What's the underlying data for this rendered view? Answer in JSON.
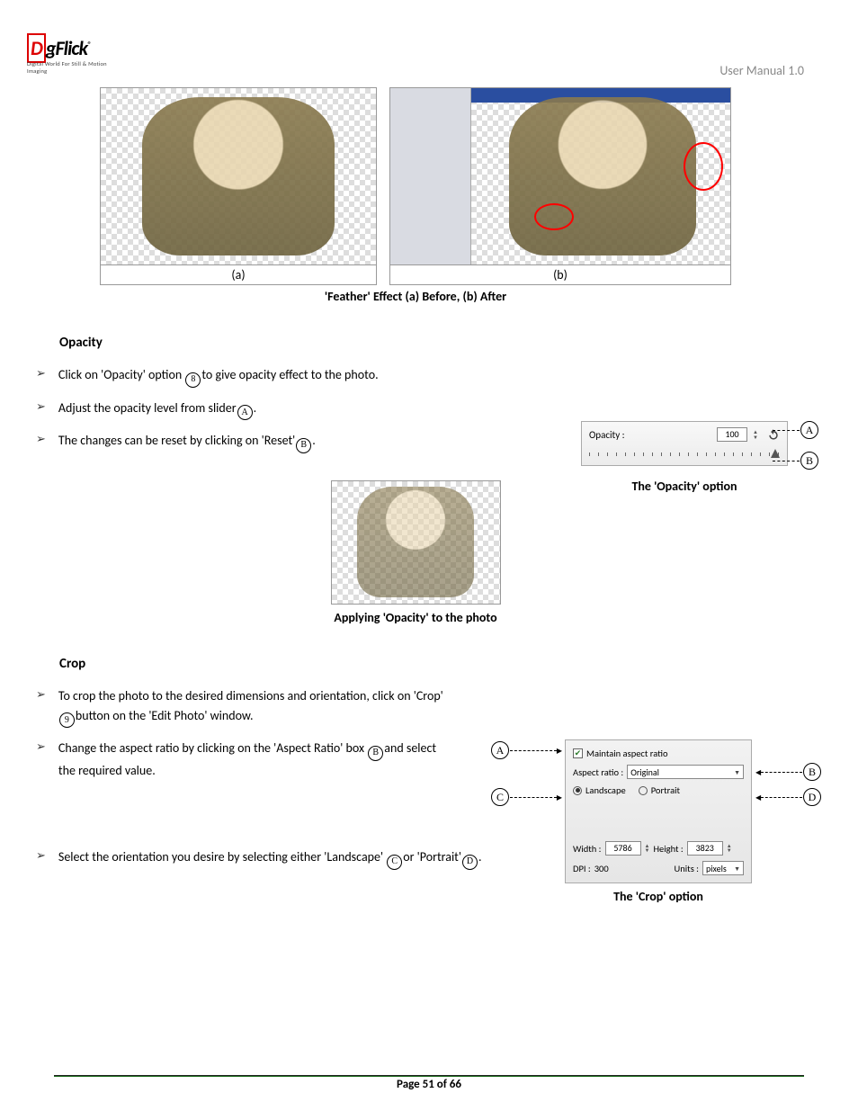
{
  "header": {
    "brand": "DgFlick",
    "brand_sub": "Digital World For Still & Motion Imaging",
    "manual": "User Manual 1.0"
  },
  "fig1": {
    "a": "(a)",
    "b": "(b)",
    "caption": "'Feather' Effect (a) Before, (b) After"
  },
  "opacity": {
    "heading": "Opacity",
    "b1_a": "Click on 'Opacity' option ",
    "b1_b": "to give opacity effect to the photo.",
    "b2_a": "Adjust the opacity level from slider",
    "b2_b": ".",
    "b3_a": "The changes can be reset by clicking on 'Reset'",
    "b3_b": ".",
    "panel": {
      "label": "Opacity :",
      "value": "100"
    },
    "panel_caption": "The 'Opacity' option",
    "apply_caption": "Applying 'Opacity' to the photo"
  },
  "crop": {
    "heading": "Crop",
    "b1_a": "To crop the photo to the desired dimensions and orientation, click on 'Crop' ",
    "b1_b": "button on the 'Edit Photo' window.",
    "b2_a": "Change the aspect ratio by clicking on the 'Aspect Ratio' box ",
    "b2_b": "and select the required value.",
    "b3_a": "Select the orientation you desire by selecting either 'Landscape' ",
    "b3_b": "or 'Portrait'",
    "b3_c": ".",
    "panel": {
      "maintain": "Maintain aspect ratio",
      "aspect_label": "Aspect ratio :",
      "aspect_value": "Original",
      "landscape": "Landscape",
      "portrait": "Portrait",
      "width_l": "Width :",
      "width_v": "5786",
      "height_l": "Height :",
      "height_v": "3823",
      "dpi_l": "DPI :",
      "dpi_v": "300",
      "units_l": "Units :",
      "units_v": "pixels"
    },
    "panel_caption": "The 'Crop' option"
  },
  "markers": {
    "A": "A",
    "B": "B",
    "C": "C",
    "D": "D",
    "n8": "8",
    "n9": "9"
  },
  "footer": {
    "page": "Page 51 of 66"
  }
}
